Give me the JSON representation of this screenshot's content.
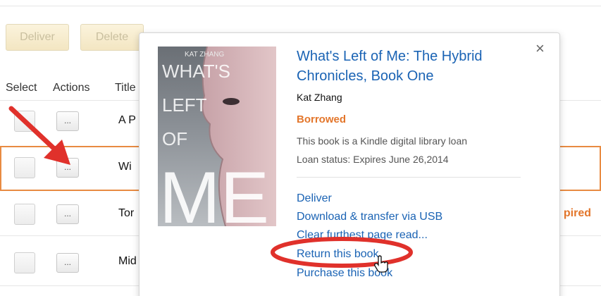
{
  "toolbar": {
    "deliver_label": "Deliver",
    "delete_label": "Delete"
  },
  "columns": {
    "select": "Select",
    "actions": "Actions",
    "title": "Title"
  },
  "rows": [
    {
      "title": "A P",
      "status": "",
      "selected": false
    },
    {
      "title": "Wi",
      "status": "",
      "selected": true
    },
    {
      "title": "Tor",
      "status": "pired",
      "selected": false
    },
    {
      "title": "Mid",
      "status": "",
      "selected": false
    }
  ],
  "actions_button_label": "...",
  "popover": {
    "close_label": "×",
    "cover": {
      "author_text": "KAT ZHANG",
      "title_lines": [
        "WHAT'S",
        "LEFT",
        "OF"
      ],
      "big_text": "ME"
    },
    "title": "What's Left of Me: The Hybrid Chronicles, Book One",
    "author": "Kat Zhang",
    "status": "Borrowed",
    "description": "This book is a Kindle digital library loan",
    "loan_status": "Loan status: Expires  June 26,2014",
    "links": [
      "Deliver",
      "Download & transfer via USB",
      "Clear furthest page read...",
      "Return this book",
      "Purchase this book"
    ]
  },
  "colors": {
    "link": "#1a63b4",
    "accent_orange": "#e3762b",
    "annotation_red": "#e0312b"
  }
}
